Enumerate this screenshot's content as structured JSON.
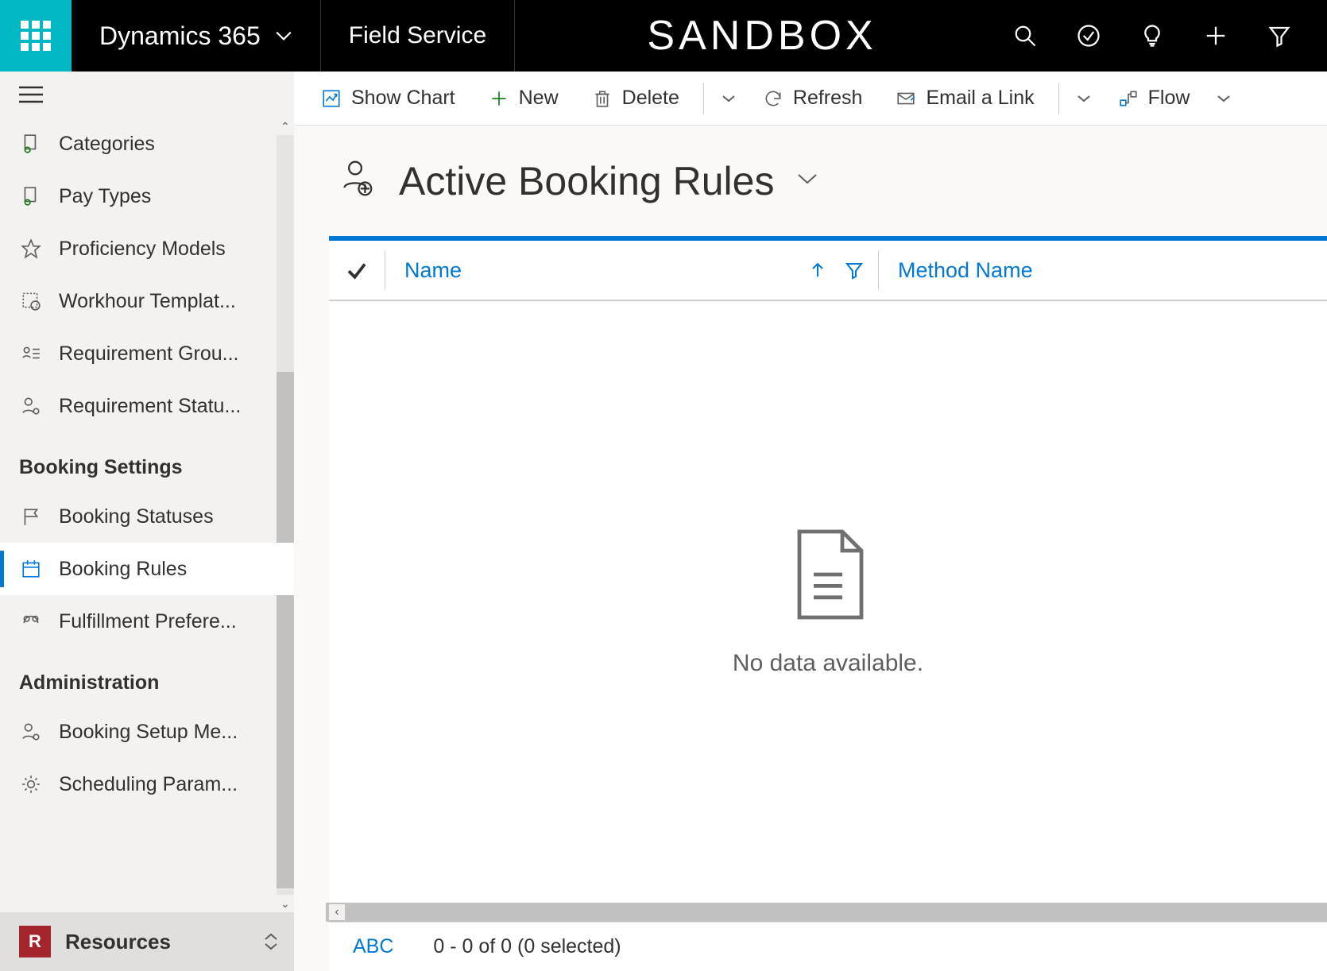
{
  "top": {
    "app_name": "Dynamics 365",
    "module": "Field Service",
    "env_label": "SANDBOX"
  },
  "sidebar": {
    "items_above": [
      {
        "label": "Categories",
        "icon": "document-person-icon"
      },
      {
        "label": "Pay Types",
        "icon": "document-person-icon"
      },
      {
        "label": "Proficiency Models",
        "icon": "star-icon"
      },
      {
        "label": "Workhour Templat...",
        "icon": "calendar-clock-icon"
      },
      {
        "label": "Requirement Grou...",
        "icon": "people-list-icon"
      },
      {
        "label": "Requirement Statu...",
        "icon": "person-gear-icon"
      }
    ],
    "group1_title": "Booking Settings",
    "group1_items": [
      {
        "label": "Booking Statuses",
        "icon": "flag-icon",
        "active": false
      },
      {
        "label": "Booking Rules",
        "icon": "calendar-icon",
        "active": true
      },
      {
        "label": "Fulfillment Prefere...",
        "icon": "people-cycle-icon",
        "active": false
      }
    ],
    "group2_title": "Administration",
    "group2_items": [
      {
        "label": "Booking Setup Me...",
        "icon": "person-gear-icon"
      },
      {
        "label": "Scheduling Param...",
        "icon": "gear-icon"
      }
    ],
    "area_badge": "R",
    "area_label": "Resources"
  },
  "commands": {
    "show_chart": "Show Chart",
    "new": "New",
    "delete": "Delete",
    "refresh": "Refresh",
    "email_link": "Email a Link",
    "flow": "Flow"
  },
  "view": {
    "title": "Active Booking Rules"
  },
  "grid": {
    "columns": {
      "name": "Name",
      "method_name": "Method Name"
    },
    "empty_text": "No data available."
  },
  "status": {
    "abc": "ABC",
    "count_text": "0 - 0 of 0 (0 selected)"
  }
}
